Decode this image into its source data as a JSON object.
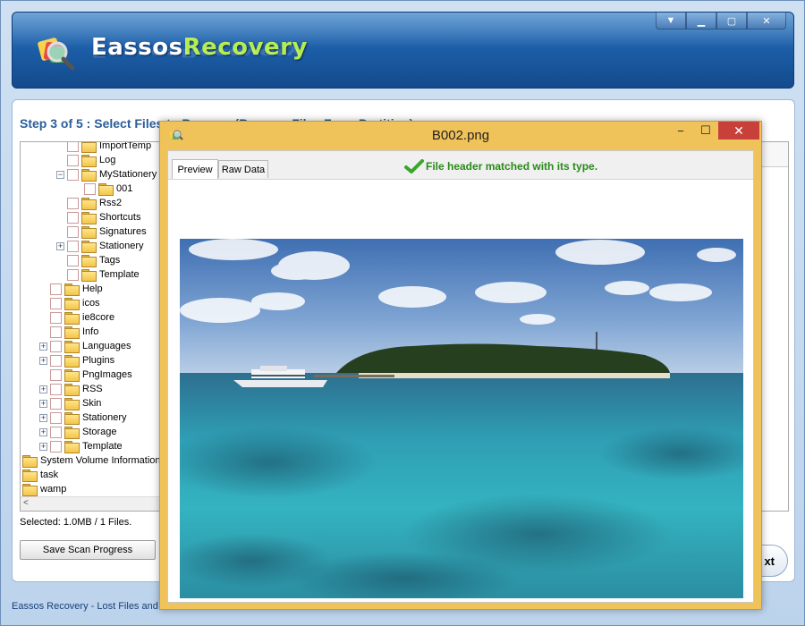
{
  "app": {
    "title_prefix": "Eassos",
    "title_accent": "Recovery",
    "status_text": "Eassos Recovery - Lost Files and"
  },
  "window_controls": {
    "dropdown": "▼",
    "minimize": "▁",
    "maximize": "▢",
    "close": "✕"
  },
  "step": {
    "title": "Step 3 of 5 : Select Files to Recover (Recover Files From Partition)"
  },
  "tree": {
    "items": [
      {
        "label": "ImportTemp",
        "level": 2,
        "expander": ""
      },
      {
        "label": "Log",
        "level": 2,
        "expander": ""
      },
      {
        "label": "MyStationery",
        "level": 2,
        "expander": "−"
      },
      {
        "label": "001",
        "level": 3,
        "expander": ""
      },
      {
        "label": "Rss2",
        "level": 2,
        "expander": ""
      },
      {
        "label": "Shortcuts",
        "level": 2,
        "expander": ""
      },
      {
        "label": "Signatures",
        "level": 2,
        "expander": ""
      },
      {
        "label": "Stationery",
        "level": 2,
        "expander": "+"
      },
      {
        "label": "Tags",
        "level": 2,
        "expander": ""
      },
      {
        "label": "Template",
        "level": 2,
        "expander": ""
      },
      {
        "label": "Help",
        "level": 1,
        "expander": ""
      },
      {
        "label": "icos",
        "level": 1,
        "expander": ""
      },
      {
        "label": "ie8core",
        "level": 1,
        "expander": ""
      },
      {
        "label": "Info",
        "level": 1,
        "expander": ""
      },
      {
        "label": "Languages",
        "level": 1,
        "expander": "+"
      },
      {
        "label": "Plugins",
        "level": 1,
        "expander": "+"
      },
      {
        "label": "PngImages",
        "level": 1,
        "expander": ""
      },
      {
        "label": "RSS",
        "level": 1,
        "expander": "+"
      },
      {
        "label": "Skin",
        "level": 1,
        "expander": "+"
      },
      {
        "label": "Stationery",
        "level": 1,
        "expander": "+"
      },
      {
        "label": "Storage",
        "level": 1,
        "expander": "+"
      },
      {
        "label": "Template",
        "level": 1,
        "expander": "+"
      },
      {
        "label": "System Volume Information",
        "level": 0,
        "expander": ""
      },
      {
        "label": "task",
        "level": 0,
        "expander": ""
      },
      {
        "label": "wamp",
        "level": 0,
        "expander": ""
      }
    ],
    "scroll_left": "<"
  },
  "selection": {
    "info": "Selected: 1.0MB / 1 Files."
  },
  "buttons": {
    "save_scan": "Save Scan Progress",
    "next": "xt"
  },
  "preview_dialog": {
    "title": "B002.png",
    "minimize": "−",
    "maximize": "☐",
    "close": "✕",
    "tabs": [
      {
        "label": "Preview",
        "active": true
      },
      {
        "label": "Raw Data",
        "active": false
      }
    ],
    "match_message": "File header matched with its type."
  },
  "colors": {
    "banner_top": "#3f86c9",
    "banner_bottom": "#134a8c",
    "accent_green": "#b4ec4e",
    "step_title": "#2a5d9a",
    "dialog_frame": "#f0c25a",
    "close_red": "#c7403a",
    "match_green": "#2a8a1a"
  }
}
